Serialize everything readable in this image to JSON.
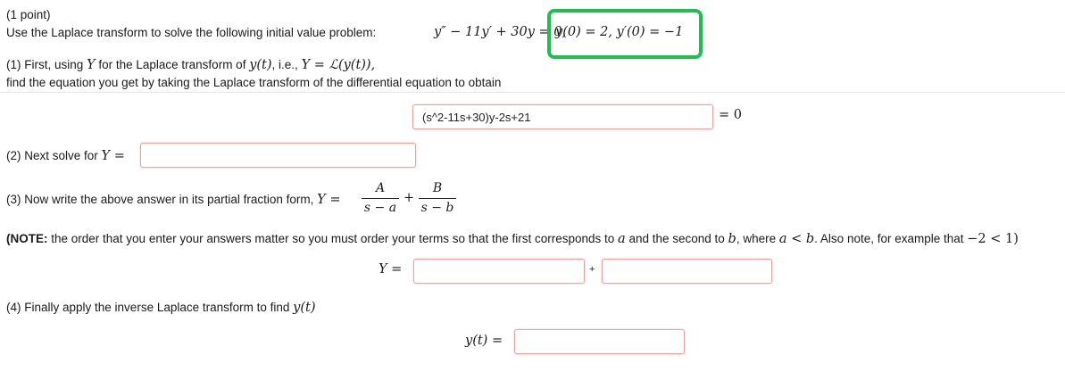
{
  "header": {
    "points": "(1 point)"
  },
  "problem": {
    "intro": "Use the Laplace transform to solve the following initial value problem:",
    "ode": "y″ − 11y′ + 30y = 0,",
    "ic": "y(0) = 2, y′(0) = −1"
  },
  "part1": {
    "line1_a": "(1) First, using ",
    "line1_Y": "Y",
    "line1_b": " for the Laplace transform of ",
    "line1_yt": "y(t)",
    "line1_c": ", i.e., ",
    "line1_def": "Y = ℒ(y(t)),",
    "line2": "find the equation you get by taking the Laplace transform of the differential equation to obtain",
    "answer_value": "(s^2-11s+30)y-2s+21",
    "equals_zero": "= 0"
  },
  "part2": {
    "label": "(2) Next solve for ",
    "var": "Y =",
    "answer_value": ""
  },
  "part3": {
    "label": "(3) Now write the above answer in its partial fraction form, ",
    "var": "Y =",
    "numA": "A",
    "denA": "s − a",
    "plus": "+",
    "numB": "B",
    "denB": "s − b"
  },
  "note": {
    "bold": "(NOTE:",
    "text1": " the order that you enter your answers matter so you must order your terms so that the first corresponds to ",
    "a": "a",
    "text2": " and the second to ",
    "b": "b",
    "text3": ", where ",
    "ab": "a < b",
    "text4": ". Also note, for example that ",
    "example": "−2 < 1)"
  },
  "part3_answer": {
    "var": "Y =",
    "plus": "+",
    "value1": "",
    "value2": ""
  },
  "part4": {
    "label": "(4) Finally apply the inverse Laplace transform to find ",
    "var": "y(t)",
    "answer_label": "y(t) =",
    "answer_value": ""
  }
}
